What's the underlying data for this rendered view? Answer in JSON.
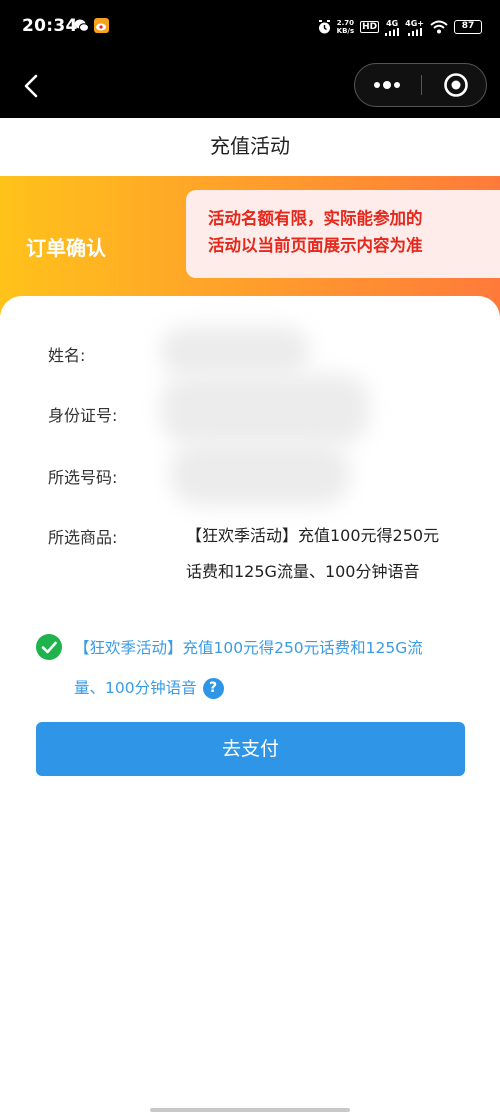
{
  "status_bar": {
    "time": "20:34",
    "speed_value": "2.70",
    "speed_unit": "KB/s",
    "hd_label": "HD",
    "sim1_label": "4G",
    "sim2_label": "4G+",
    "battery": "87"
  },
  "page": {
    "title": "充值活动"
  },
  "banner": {
    "heading": "订单确认",
    "notice_line1": "活动名额有限，实际能参加的",
    "notice_line2": "活动以当前页面展示内容为准"
  },
  "form": {
    "name_label": "姓名:",
    "id_label": "身份证号:",
    "number_label": "所选号码:",
    "product_label": "所选商品:",
    "product_line1": "【狂欢季活动】充值100元得250元",
    "product_line2": "话费和125G流量、100分钟语音"
  },
  "agreement": {
    "line1": "【狂欢季活动】充值100元得250元话费和125G流",
    "line2": "量、100分钟语音",
    "help_symbol": "?"
  },
  "actions": {
    "pay_label": "去支付"
  },
  "colors": {
    "accent_blue": "#2f95e6",
    "check_green": "#1fb34d",
    "notice_red": "#e6271b",
    "banner_start": "#ffc21a",
    "banner_end": "#ff7a3a"
  }
}
